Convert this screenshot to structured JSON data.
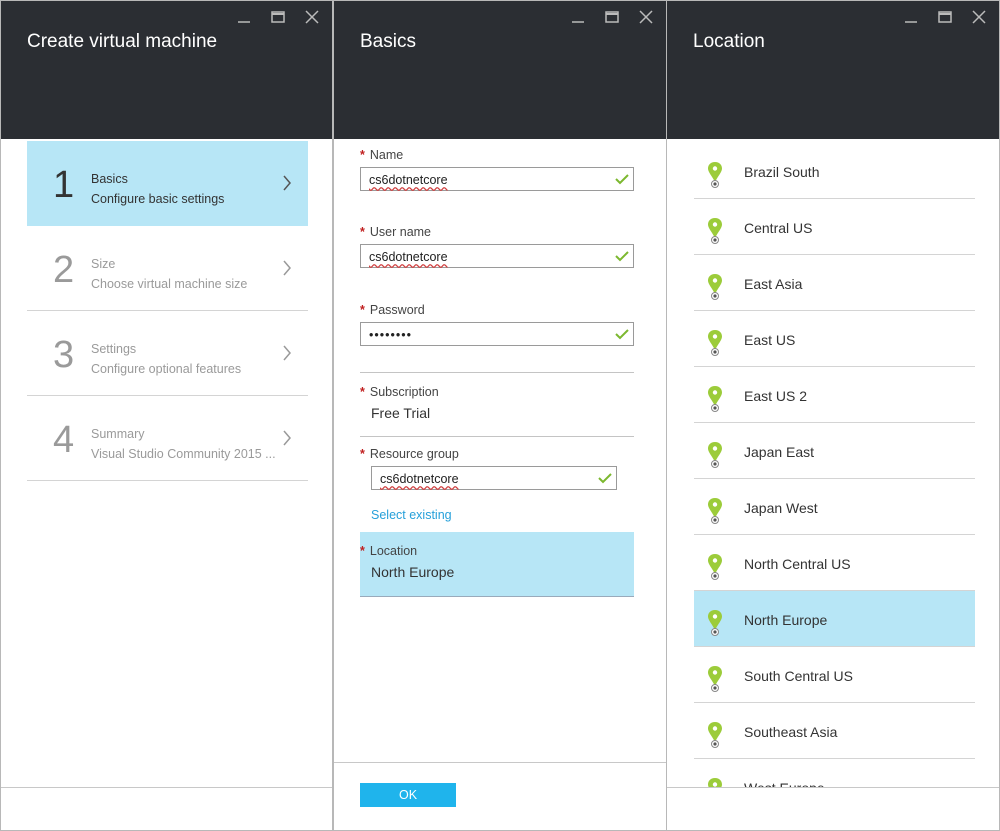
{
  "window_controls": {
    "minimize": "minimize-icon",
    "maximize": "maximize-icon",
    "close": "close-icon"
  },
  "blade1": {
    "title": "Create virtual machine",
    "steps": [
      {
        "number": "1",
        "title": "Basics",
        "subtitle": "Configure basic settings",
        "active": true
      },
      {
        "number": "2",
        "title": "Size",
        "subtitle": "Choose virtual machine size",
        "active": false
      },
      {
        "number": "3",
        "title": "Settings",
        "subtitle": "Configure optional features",
        "active": false
      },
      {
        "number": "4",
        "title": "Summary",
        "subtitle": "Visual Studio Community 2015 ...",
        "active": false
      }
    ]
  },
  "blade2": {
    "title": "Basics",
    "fields": {
      "name": {
        "label": "Name",
        "value": "cs6dotnetcore"
      },
      "username": {
        "label": "User name",
        "value": "cs6dotnetcore"
      },
      "password": {
        "label": "Password",
        "value": "••••••••"
      },
      "subscription": {
        "label": "Subscription",
        "value": "Free Trial"
      },
      "resource_group": {
        "label": "Resource group",
        "value": "cs6dotnetcore",
        "link": "Select existing"
      },
      "location": {
        "label": "Location",
        "value": "North Europe"
      }
    },
    "required_marker": "*",
    "ok_button": "OK"
  },
  "blade3": {
    "title": "Location",
    "items": [
      {
        "name": "Brazil South",
        "active": false
      },
      {
        "name": "Central US",
        "active": false
      },
      {
        "name": "East Asia",
        "active": false
      },
      {
        "name": "East US",
        "active": false
      },
      {
        "name": "East US 2",
        "active": false
      },
      {
        "name": "Japan East",
        "active": false
      },
      {
        "name": "Japan West",
        "active": false
      },
      {
        "name": "North Central US",
        "active": false
      },
      {
        "name": "North Europe",
        "active": true
      },
      {
        "name": "South Central US",
        "active": false
      },
      {
        "name": "Southeast Asia",
        "active": false
      },
      {
        "name": "West Europe",
        "active": false
      }
    ]
  },
  "colors": {
    "header": "#2b2e33",
    "selection": "#b7e6f6",
    "accent": "#1fb4ec",
    "link": "#26a0da",
    "pin": "#9ccc3a",
    "check": "#7cb82f"
  }
}
